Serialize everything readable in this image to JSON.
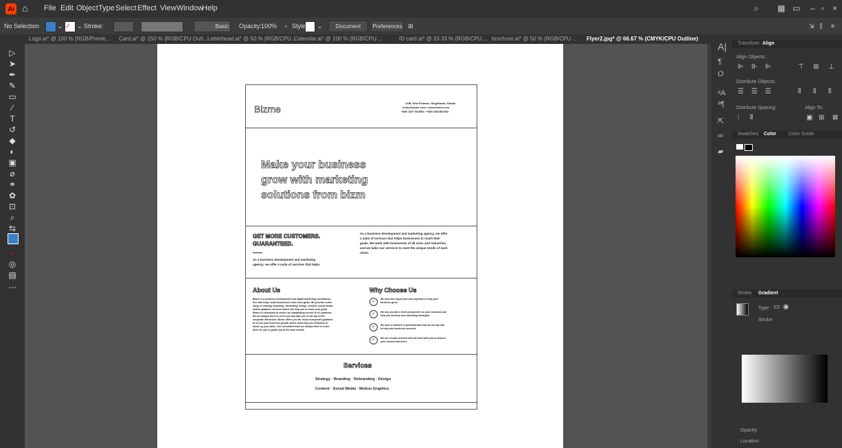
{
  "menubar": {
    "app_icon": "Ai",
    "home_icon": "home-icon",
    "items": [
      "File",
      "Edit",
      "Object",
      "Type",
      "Select",
      "Effect",
      "View",
      "Window",
      "Help"
    ]
  },
  "controlbar": {
    "selection": "No Selection",
    "stroke_label": "Stroke:",
    "stroke_style": "Basic",
    "opacity_label": "Opacity:",
    "opacity_value": "100%",
    "style_label": "Style:",
    "document_setup": "Document Setup",
    "preferences": "Preferences"
  },
  "tabs": [
    "Logo.ai* @ 100 % (RGB/Previe...",
    "Card.ai* @ 150 % (RGB/CPU Outl...",
    "Letterhead.ai* @ 50 % (RGB/CPU...",
    "Calendar.ai* @ 100 % (RGB/CPU ...",
    "ID card.ai* @ 33.33 % (RGB/CPU ...",
    "brochure.ai* @ 50 % (RGB/CPU ...",
    "Flyer2.jpg* @ 66.67 % (CMYK/CPU Outline)"
  ],
  "flyer": {
    "logo": "Bizme",
    "contact_line1": "12/B, New Eskaton, Moghbazar, Dhaka",
    "contact_line2": "hello@bizme.com / www.bizme.com",
    "contact_line3": "+880 1827 964500 / +880 1861891902",
    "headline1": "Make your business",
    "headline2": "grow with marketing",
    "headline3": "solutions from bizm",
    "sub_heading1": "GET MORE CUSTOMERS.",
    "sub_heading2": "GUARANTEED.",
    "sub_italic1": "As a business development and marketing",
    "sub_italic2": "agency, we offer a suite of services that helps",
    "intro1": "As a business development and marketing agency, we offer",
    "intro2": "a suite of services that helps businesses to reach their",
    "intro3": "goals. We work with businesses of all sizes and industries,",
    "intro4": "and we tailor our services to meet the unique needs of each",
    "intro5": "client.",
    "about_title": "About Us",
    "about_lines": [
      "Bizme is a business development and digital marketing consultancy",
      "firm that helps small businesses reach their goals. We provide a wide",
      "range of strategy, branding, rebranding, design, content, social media,",
      "motion graphics services which will help you to reach your goals.",
      "Bizme is committed to ensure an outstanding service to it's audience.",
      "We are always there to serve you and take you to the top of the",
      "corporate dimension. Bizme offers you the most unexpected guidance",
      "to enrich your business growth which could help you definitely to",
      "boost up your sales. Our consultant team are always there to solve",
      "them for you to guide you to the best results!"
    ],
    "why_title": "Why Choose Us",
    "why_items": [
      [
        "We have the experience and expertise to help your",
        "business grow"
      ],
      [
        "We can provide a fresh perspective on your business and",
        "help you develop new marketing strategies"
      ],
      [
        "We have a network of professionals that we can tap into",
        "to help your business succeed."
      ],
      [
        "We are results-oriented and will work with you to achieve",
        "your desired outcomes"
      ]
    ],
    "services_title": "Services",
    "services_line1": "Strategy  ◦  Branding  ◦  Rebranding  ◦  Design",
    "services_line2": "Content  ◦  Social Media  ◦  Motion Graphics"
  },
  "panels": {
    "transform_tab": "Transform",
    "align_tab": "Align",
    "align_objects": "Align Objects:",
    "distribute_objects": "Distribute Objects:",
    "distribute_spacing": "Distribute Spacing:",
    "align_to": "Align To:",
    "swatches_tab": "Swatches",
    "color_tab": "Color",
    "color_guide_tab": "Color Guide",
    "stroke_tab": "Stroke",
    "gradient_tab": "Gradient",
    "type_label": "Type:",
    "stroke_label": "Stroke:",
    "opacity_label": "Opacity:",
    "location_label": "Location:"
  }
}
